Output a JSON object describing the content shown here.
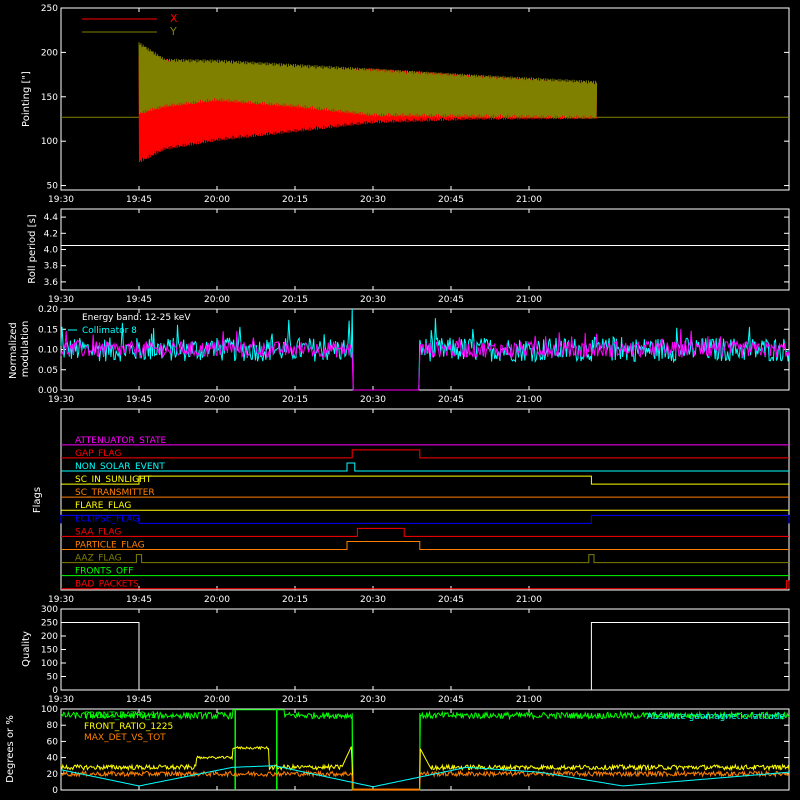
{
  "time_axis": {
    "range_min": [
      1170,
      1310
    ],
    "ticks": [
      {
        "min": 1170,
        "label": "19:30"
      },
      {
        "min": 1185,
        "label": "19:45"
      },
      {
        "min": 1200,
        "label": "20:00"
      },
      {
        "min": 1215,
        "label": "20:15"
      },
      {
        "min": 1230,
        "label": "20:30"
      },
      {
        "min": 1245,
        "label": "20:45"
      },
      {
        "min": 1260,
        "label": "21:00"
      }
    ]
  },
  "chart_data": [
    {
      "id": "pointing",
      "type": "line",
      "ylabel": "Pointing [\"]",
      "ylim": [
        45,
        250
      ],
      "yticks": [
        50,
        100,
        150,
        200,
        250
      ],
      "legend": [
        {
          "name": "X",
          "color": "#ff0000"
        },
        {
          "name": "Y",
          "color": "#808000"
        }
      ],
      "baseline": 127,
      "data_start": 1185,
      "data_end": 1273,
      "series": [
        {
          "name": "X",
          "color": "#ff0000",
          "upper": [
            [
              1185,
              200
            ],
            [
              1195,
              185
            ],
            [
              1210,
              180
            ],
            [
              1230,
              182
            ],
            [
              1273,
              165
            ]
          ],
          "lower": [
            [
              1185,
              75
            ],
            [
              1190,
              90
            ],
            [
              1200,
              100
            ],
            [
              1215,
              110
            ],
            [
              1230,
              120
            ],
            [
              1250,
              124
            ],
            [
              1273,
              125
            ]
          ]
        },
        {
          "name": "Y",
          "color": "#808000",
          "upper": [
            [
              1185,
              212
            ],
            [
              1190,
              193
            ],
            [
              1200,
              192
            ],
            [
              1230,
              182
            ],
            [
              1250,
              175
            ],
            [
              1273,
              168
            ]
          ],
          "lower": [
            [
              1185,
              130
            ],
            [
              1190,
              138
            ],
            [
              1200,
              145
            ],
            [
              1215,
              138
            ],
            [
              1230,
              128
            ],
            [
              1273,
              125
            ]
          ]
        }
      ]
    },
    {
      "id": "roll_period",
      "type": "line",
      "ylabel": "Roll period [s]",
      "ylim": [
        3.5,
        4.5
      ],
      "yticks": [
        3.6,
        3.8,
        4.0,
        4.2,
        4.4
      ],
      "ytick_labels": [
        "3.6",
        "3.8",
        "4.0",
        "4.2",
        "4.4"
      ],
      "series": [
        {
          "name": "",
          "color": "#ffffff",
          "x": [
            1170,
            1310
          ],
          "y": [
            4.05,
            4.05
          ]
        }
      ]
    },
    {
      "id": "modulation",
      "type": "line",
      "ylabel": "Normalized modulation",
      "ylim": [
        0,
        0.2
      ],
      "yticks": [
        0.0,
        0.05,
        0.1,
        0.15,
        0.2
      ],
      "ytick_labels": [
        "0.00",
        "0.05",
        "0.10",
        "0.15",
        "0.20"
      ],
      "annotations": [
        "Energy band: 12-25 keV",
        "Collimator 8"
      ],
      "legend": [
        {
          "name": "Collimator 8",
          "color": "#00ffff"
        }
      ],
      "gap": [
        1226,
        1239
      ],
      "series": [
        {
          "name": "Collimator 8",
          "color": "#00ffff",
          "mean": 0.1,
          "spread": 0.03
        },
        {
          "name": "",
          "color": "#ff00ff",
          "mean": 0.1,
          "spread": 0.02
        }
      ]
    },
    {
      "id": "flags",
      "type": "line",
      "ylabel": "Flags",
      "series": [
        {
          "name": "ATTENUATOR_STATE",
          "color": "#ff00ff",
          "on": []
        },
        {
          "name": "GAP_FLAG",
          "color": "#ff0000",
          "on": [
            [
              1226,
              1239
            ]
          ]
        },
        {
          "name": "NON_SOLAR_EVENT",
          "color": "#00ffff",
          "on": [
            [
              1225,
              1226.5
            ]
          ]
        },
        {
          "name": "SC_IN_SUNLIGHT",
          "color": "#ffff00",
          "on": [
            [
              1185,
              1272
            ]
          ]
        },
        {
          "name": "SC_TRANSMITTER",
          "color": "#ff8000",
          "on": []
        },
        {
          "name": "FLARE_FLAG",
          "color": "#ffff00",
          "on": []
        },
        {
          "name": "ECLIPSE_FLAG",
          "color": "#0000ff",
          "on": [
            [
              1170,
              1185
            ],
            [
              1272,
              1310
            ]
          ],
          "on_at_start": true
        },
        {
          "name": "SAA_FLAG",
          "color": "#ff0000",
          "on": [
            [
              1227,
              1236
            ]
          ]
        },
        {
          "name": "PARTICLE_FLAG",
          "color": "#ff8000",
          "on": [
            [
              1225,
              1239
            ]
          ]
        },
        {
          "name": "AAZ_FLAG",
          "color": "#808000",
          "on": [
            [
              1184.5,
              1185.5
            ],
            [
              1271.5,
              1272.5
            ]
          ]
        },
        {
          "name": "FRONTS_OFF",
          "color": "#00ff00",
          "on": []
        },
        {
          "name": "BAD_PACKETS",
          "color": "#ff0000",
          "on": [
            [
              1309.5,
              1310
            ]
          ]
        }
      ]
    },
    {
      "id": "quality",
      "type": "line",
      "ylabel": "Quality",
      "ylim": [
        0,
        300
      ],
      "yticks": [
        0,
        50,
        100,
        150,
        200,
        250,
        300
      ],
      "series": [
        {
          "name": "",
          "color": "#ffffff",
          "high": 250,
          "low": 0,
          "x_fall": 1185,
          "x_rise": 1272
        }
      ]
    },
    {
      "id": "detector",
      "type": "line",
      "ylabel": "Degrees or %",
      "ylim": [
        0,
        100
      ],
      "yticks": [
        0,
        20,
        40,
        60,
        80,
        100
      ],
      "legend": [
        {
          "name": "FRONT_RATIO_1",
          "color": "#00ff00"
        },
        {
          "name": "FRONT_RATIO_1225",
          "color": "#ffff00"
        },
        {
          "name": "MAX_DET_VS_TOT",
          "color": "#ff8000"
        }
      ],
      "annotation": "Absolute geomagnetic latitude",
      "annotation_color": "#00ffff",
      "series": [
        {
          "name": "FRONT_RATIO_1",
          "color": "#00ff00",
          "base": 92,
          "spikes": [
            1203.5,
            1211.5
          ],
          "gap": [
            1226,
            1239
          ]
        },
        {
          "name": "FRONT_RATIO_1225",
          "color": "#ffff00",
          "base": 28,
          "step": [
            [
              1196,
              1203,
              40
            ],
            [
              1203,
              1210,
              52
            ]
          ],
          "gap": [
            1226,
            1239
          ]
        },
        {
          "name": "MAX_DET_VS_TOT",
          "color": "#ff8000",
          "base": 20,
          "gap": [
            1226,
            1239
          ]
        },
        {
          "name": "Absolute geomagnetic latitude",
          "color": "#00ffff",
          "latitude": [
            [
              1170,
              25
            ],
            [
              1185,
              5
            ],
            [
              1203,
              28
            ],
            [
              1211,
              30
            ],
            [
              1230,
              4
            ],
            [
              1248,
              28
            ],
            [
              1262,
              22
            ],
            [
              1278,
              5
            ],
            [
              1310,
              22
            ]
          ]
        }
      ]
    }
  ]
}
